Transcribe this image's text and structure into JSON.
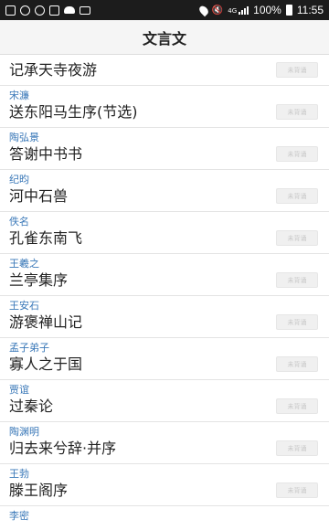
{
  "status_bar": {
    "battery": "100%",
    "time": "11:55"
  },
  "header": {
    "title": "文言文"
  },
  "items": [
    {
      "author": "",
      "title": "记承天寺夜游",
      "button": "未背诵"
    },
    {
      "author": "宋濂",
      "title": "送东阳马生序(节选)",
      "button": "未背诵"
    },
    {
      "author": "陶弘景",
      "title": "答谢中书书",
      "button": "未背诵"
    },
    {
      "author": "纪昀",
      "title": "河中石兽",
      "button": "未背诵"
    },
    {
      "author": "佚名",
      "title": "孔雀东南飞",
      "button": "未背诵"
    },
    {
      "author": "王羲之",
      "title": "兰亭集序",
      "button": "未背诵"
    },
    {
      "author": "王安石",
      "title": "游褒禅山记",
      "button": "未背诵"
    },
    {
      "author": "孟子弟子",
      "title": "寡人之于国",
      "button": "未背诵"
    },
    {
      "author": "贾谊",
      "title": "过秦论",
      "button": "未背诵"
    },
    {
      "author": "陶渊明",
      "title": "归去来兮辞·并序",
      "button": "未背诵"
    },
    {
      "author": "王勃",
      "title": "滕王阁序",
      "button": "未背诵"
    },
    {
      "author": "李密",
      "title": "",
      "button": ""
    }
  ]
}
